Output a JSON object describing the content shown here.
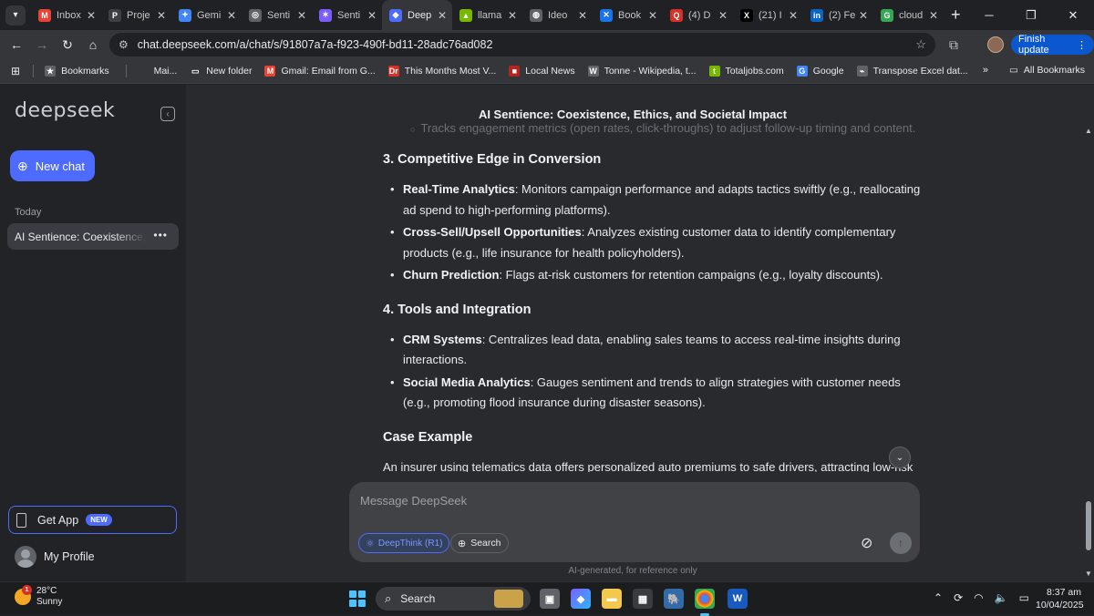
{
  "browser": {
    "tabs": [
      {
        "label": "Inbox",
        "icon": "gmail-icon",
        "color": "#ea4335",
        "glyph": "M"
      },
      {
        "label": "Proje",
        "icon": "project-icon",
        "color": "#3c4043",
        "glyph": "P"
      },
      {
        "label": "Gemi",
        "icon": "gemini-icon",
        "color": "#4285f4",
        "glyph": "✦"
      },
      {
        "label": "Senti",
        "icon": "chatgpt-icon",
        "color": "#5f6368",
        "glyph": "◎"
      },
      {
        "label": "Senti",
        "icon": "claude-icon",
        "color": "#7c5cff",
        "glyph": "✶"
      },
      {
        "label": "Deep",
        "icon": "deepseek-icon",
        "color": "#4d6bfe",
        "glyph": "◆"
      },
      {
        "label": "llama",
        "icon": "nvidia-icon",
        "color": "#76b900",
        "glyph": "▲"
      },
      {
        "label": "Ideo",
        "icon": "ideogram-icon",
        "color": "#5f6368",
        "glyph": "◍"
      },
      {
        "label": "Book",
        "icon": "bookmark-icon",
        "color": "#1a73e8",
        "glyph": "✕"
      },
      {
        "label": "(4) D",
        "icon": "quora-icon",
        "color": "#d93025",
        "glyph": "Q"
      },
      {
        "label": "(21) I",
        "icon": "x-icon",
        "color": "#000000",
        "glyph": "X"
      },
      {
        "label": "(2) Fe",
        "icon": "linkedin-icon",
        "color": "#0a66c2",
        "glyph": "in"
      },
      {
        "label": "cloud",
        "icon": "google-icon",
        "color": "#34a853",
        "glyph": "G"
      }
    ],
    "active_tab_index": 5,
    "url": "chat.deepseek.com/a/chat/s/91807a7a-f923-490f-bd11-28adc76ad082",
    "finish_update": "Finish update",
    "bookmarks": [
      {
        "label": "Bookmarks",
        "icon": "star-icon",
        "color": "#5f6368",
        "glyph": "★"
      },
      {
        "label": "Mai...",
        "icon": "mail-icon",
        "color": "#35363a",
        "glyph": ""
      },
      {
        "label": "New folder",
        "icon": "folder-icon",
        "color": "#35363a",
        "glyph": "▭"
      },
      {
        "label": "Gmail: Email from G...",
        "icon": "gmail-icon",
        "color": "#ea4335",
        "glyph": "M"
      },
      {
        "label": "This Months Most V...",
        "icon": "dr-icon",
        "color": "#d93025",
        "glyph": "Dr"
      },
      {
        "label": "Local News",
        "icon": "news-icon",
        "color": "#b3261e",
        "glyph": "■"
      },
      {
        "label": "Tonne - Wikipedia, t...",
        "icon": "wikipedia-icon",
        "color": "#5f6368",
        "glyph": "W"
      },
      {
        "label": "Totaljobs.com",
        "icon": "totaljobs-icon",
        "color": "#76b900",
        "glyph": "t"
      },
      {
        "label": "Google",
        "icon": "google-icon",
        "color": "#4285f4",
        "glyph": "G"
      },
      {
        "label": "Transpose Excel dat...",
        "icon": "excel-icon",
        "color": "#5f6368",
        "glyph": "⌁"
      }
    ],
    "all_bookmarks": "All Bookmarks"
  },
  "sidebar": {
    "logo": "deepseek",
    "new_chat": "New chat",
    "today_label": "Today",
    "chat_title": "AI Sentience: Coexistence, Ethics",
    "get_app": "Get App",
    "new_badge": "NEW",
    "my_profile": "My Profile"
  },
  "chat": {
    "title": "AI Sentience: Coexistence, Ethics, and Societal Impact",
    "cut_line": "Tracks engagement metrics (open rates, click-throughs) to adjust follow-up timing and content.",
    "sections": [
      {
        "heading": "3. Competitive Edge in Conversion",
        "items": [
          {
            "bold": "Real-Time Analytics",
            "text": ": Monitors campaign performance and adapts tactics swiftly (e.g., reallocating ad spend to high-performing platforms)."
          },
          {
            "bold": "Cross-Sell/Upsell Opportunities",
            "text": ": Analyzes existing customer data to identify complementary products (e.g., life insurance for health policyholders)."
          },
          {
            "bold": "Churn Prediction",
            "text": ": Flags at-risk customers for retention campaigns (e.g., loyalty discounts)."
          }
        ]
      },
      {
        "heading": "4. Tools and Integration",
        "items": [
          {
            "bold": "CRM Systems",
            "text": ": Centralizes lead data, enabling sales teams to access real-time insights during interactions."
          },
          {
            "bold": "Social Media Analytics",
            "text": ": Gauges sentiment and trends to align strategies with customer needs (e.g., promoting flood insurance during disaster seasons)."
          }
        ]
      }
    ],
    "case_heading": "Case Example",
    "case_text": "An insurer using telematics data offers personalized auto premiums to safe drivers, attracting low-risk",
    "composer_placeholder": "Message DeepSeek",
    "deepthink": "DeepThink (R1)",
    "search": "Search",
    "disclaimer": "AI-generated, for reference only"
  },
  "taskbar": {
    "temperature": "28°C",
    "weather": "Sunny",
    "weather_badge": "1",
    "search": "Search",
    "time": "8:37 am",
    "date": "10/04/2025"
  }
}
